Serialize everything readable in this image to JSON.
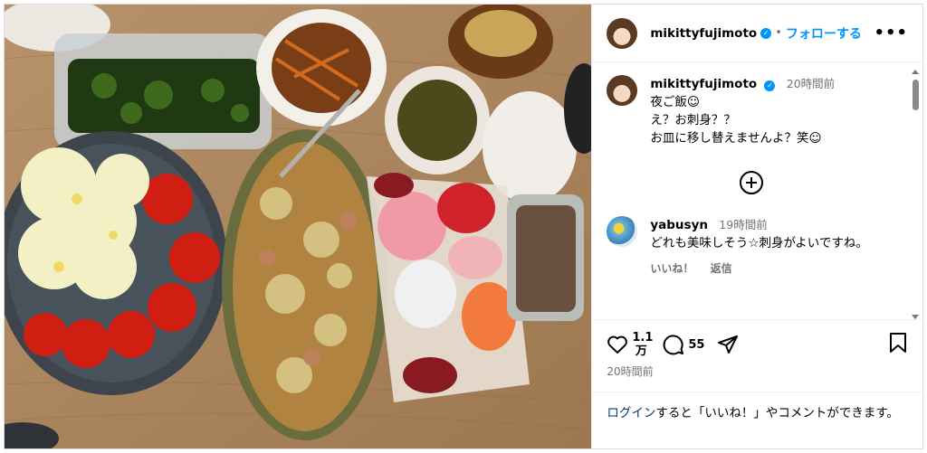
{
  "post": {
    "username": "mikittyfujimoto",
    "verified_icon": "verified-badge-icon",
    "follow_label": "フォローする",
    "more_icon": "more-options-icon",
    "dot": "•"
  },
  "caption": {
    "username": "mikittyfujimoto",
    "time": "20時間前",
    "lines": [
      "夜ご飯☺︎",
      "え？お刺身？？",
      "お皿に移し替えませんよ？笑☺︎"
    ],
    "load_more_icon": "add-circle-icon"
  },
  "comment": {
    "username": "yabusyn",
    "time": "19時間前",
    "text": "どれも美味しそう☆刺身がよいですね。",
    "like_label": "いいね！",
    "reply_label": "返信"
  },
  "actions": {
    "like_count": "1.1万",
    "comment_count": "55",
    "post_time": "20時間前"
  },
  "login": {
    "link": "ログイン",
    "rest": "すると「いいね！」やコメントができます。"
  },
  "colors": {
    "link_blue": "#0095f6",
    "login_link": "#00376b",
    "muted": "#737373"
  }
}
